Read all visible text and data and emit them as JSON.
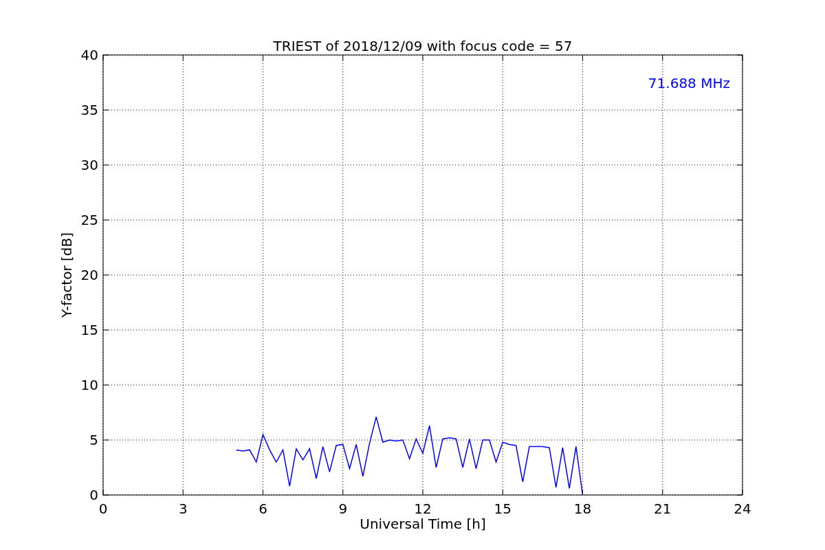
{
  "chart_data": {
    "type": "line",
    "grid": true,
    "title": "TRIEST of 2018/12/09 with focus code = 57",
    "xlabel": "Universal Time [h]",
    "ylabel": "Y-factor [dB]",
    "xlim": [
      0,
      24
    ],
    "ylim": [
      0,
      40
    ],
    "xticks": [
      0,
      3,
      6,
      9,
      12,
      15,
      18,
      21,
      24
    ],
    "yticks": [
      0,
      5,
      10,
      15,
      20,
      25,
      30,
      35,
      40
    ],
    "x": [
      5,
      5.25,
      5.5,
      5.75,
      6,
      6.25,
      6.5,
      6.75,
      7,
      7.25,
      7.5,
      7.75,
      8,
      8.25,
      8.5,
      8.75,
      9,
      9.25,
      9.5,
      9.75,
      10,
      10.25,
      10.5,
      10.75,
      11,
      11.25,
      11.5,
      11.75,
      12,
      12.25,
      12.5,
      12.75,
      13,
      13.25,
      13.5,
      13.75,
      14,
      14.25,
      14.5,
      14.75,
      15,
      15.25,
      15.5,
      15.75,
      16,
      16.25,
      16.5,
      16.75,
      17,
      17.25,
      17.5,
      17.75,
      18
    ],
    "series": [
      {
        "name": "71.688 MHz",
        "color": "#0000ff",
        "values": [
          4.1,
          4.0,
          4.1,
          3.0,
          5.5,
          4.1,
          3.0,
          4.1,
          0.8,
          4.2,
          3.2,
          4.2,
          1.5,
          4.4,
          2.1,
          4.5,
          4.6,
          2.4,
          4.6,
          1.7,
          4.7,
          7.1,
          4.8,
          5.0,
          4.9,
          5.0,
          3.3,
          5.1,
          3.8,
          6.3,
          2.5,
          5.1,
          5.2,
          5.1,
          2.5,
          5.1,
          2.4,
          5.0,
          5.0,
          3.0,
          4.8,
          4.6,
          4.5,
          1.2,
          4.4,
          4.4,
          4.4,
          4.3,
          0.7,
          4.3,
          0.6,
          4.4,
          0.0
        ]
      }
    ]
  }
}
